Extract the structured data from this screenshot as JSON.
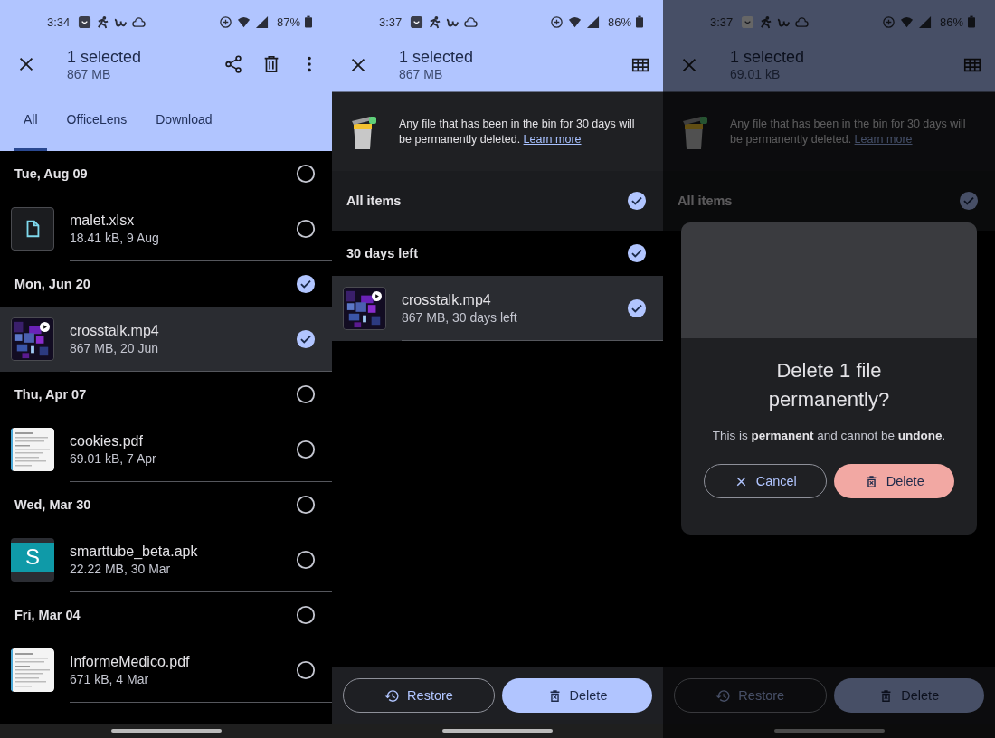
{
  "screens": [
    {
      "kind": "browse",
      "status": {
        "time": "3:34",
        "battery": "87%"
      },
      "app_bar": {
        "title": "1 selected",
        "subtitle": "867 MB",
        "actions": [
          {
            "kind": "share"
          },
          {
            "kind": "delete"
          },
          {
            "kind": "more"
          }
        ]
      },
      "tabs": [
        {
          "label": "All",
          "selected": true
        },
        {
          "label": "OfficeLens",
          "selected": false
        },
        {
          "label": "Download",
          "selected": false
        }
      ],
      "groups": [
        {
          "date": "Tue, Aug 09",
          "checked": false,
          "files": [
            {
              "name": "malet.xlsx",
              "meta": "18.41 kB, 9 Aug",
              "kind": "file",
              "checked": false
            }
          ]
        },
        {
          "date": "Mon, Jun 20",
          "checked": true,
          "files": [
            {
              "name": "crosstalk.mp4",
              "meta": "867 MB, 20 Jun",
              "kind": "video",
              "checked": true
            }
          ]
        },
        {
          "date": "Thu, Apr 07",
          "checked": false,
          "files": [
            {
              "name": "cookies.pdf",
              "meta": "69.01 kB, 7 Apr",
              "kind": "document",
              "checked": false
            }
          ]
        },
        {
          "date": "Wed, Mar 30",
          "checked": false,
          "files": [
            {
              "name": "smarttube_beta.apk",
              "meta": "22.22 MB, 30 Mar",
              "kind": "app",
              "icon_letter": "S",
              "checked": false
            }
          ]
        },
        {
          "date": "Fri, Mar 04",
          "checked": false,
          "files": [
            {
              "name": "InformeMedico.pdf",
              "meta": "671 kB, 4 Mar",
              "kind": "document",
              "checked": false
            }
          ]
        }
      ]
    },
    {
      "kind": "bin",
      "status": {
        "time": "3:37",
        "battery": "86%"
      },
      "app_bar": {
        "title": "1 selected",
        "subtitle": "867 MB",
        "actions": [
          {
            "kind": "grid"
          }
        ]
      },
      "notice": {
        "text": "Any file that has been in the bin for 30 days will be permanently deleted.",
        "link": "Learn more"
      },
      "all_items": {
        "label": "All items",
        "checked": true
      },
      "groups": [
        {
          "date": "30 days left",
          "checked": true,
          "files": [
            {
              "name": "crosstalk.mp4",
              "meta": "867 MB, 30 days left",
              "kind": "video",
              "checked": true
            }
          ]
        }
      ],
      "buttons": [
        {
          "label": "Restore",
          "kind": "restore"
        },
        {
          "label": "Delete",
          "kind": "delete"
        }
      ]
    },
    {
      "kind": "bin",
      "dimmed": true,
      "status": {
        "time": "3:37",
        "battery": "86%"
      },
      "app_bar": {
        "title": "1 selected",
        "subtitle": "69.01 kB",
        "actions": [
          {
            "kind": "grid"
          }
        ]
      },
      "notice": {
        "text": "Any file that has been in the bin for 30 days will be permanently deleted.",
        "link": "Learn more"
      },
      "all_items": {
        "label": "All items",
        "checked": true
      },
      "buttons": [
        {
          "label": "Restore",
          "kind": "restore"
        },
        {
          "label": "Delete",
          "kind": "delete"
        }
      ],
      "dialog": {
        "title": "Delete 1 file permanently?",
        "body": "This is **permanent** and cannot be **undone**.",
        "buttons": [
          {
            "label": "Cancel",
            "kind": "cancel"
          },
          {
            "label": "Delete",
            "kind": "confirm"
          }
        ]
      }
    }
  ]
}
